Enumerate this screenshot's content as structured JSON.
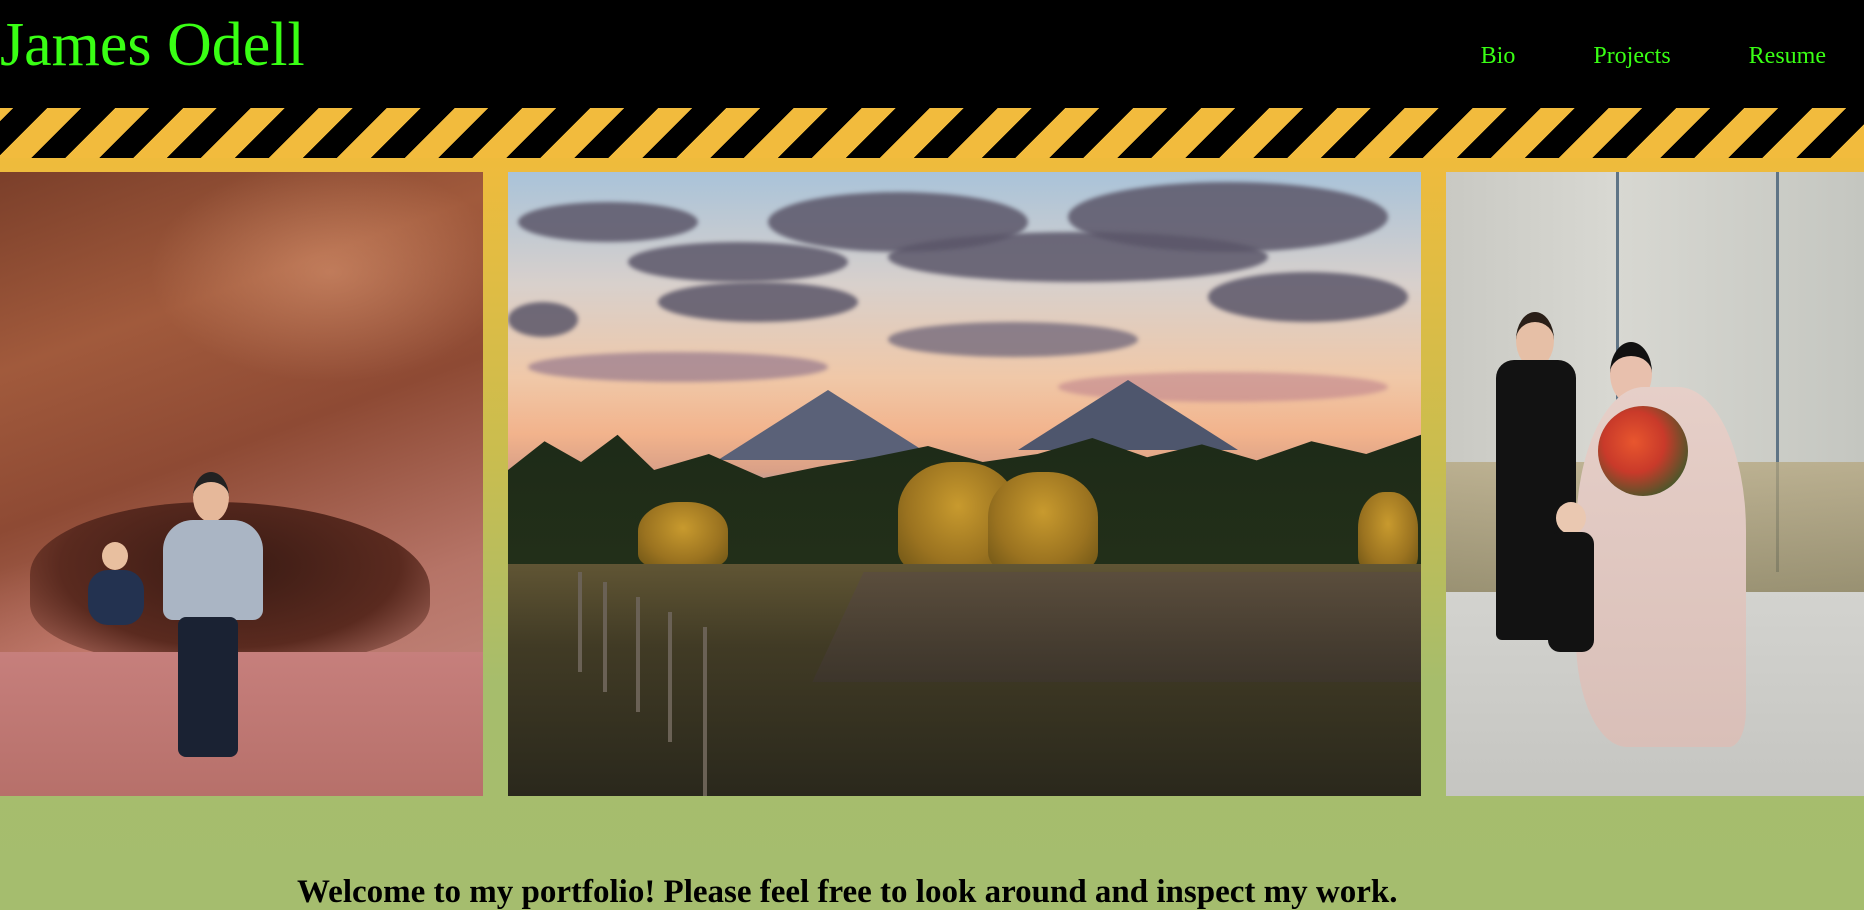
{
  "header": {
    "brand": "James Odell",
    "nav": [
      {
        "label": "Bio"
      },
      {
        "label": "Projects"
      },
      {
        "label": "Resume"
      }
    ]
  },
  "gallery": {
    "photos": [
      {
        "subject": "man and child sitting on red rock"
      },
      {
        "subject": "mountain landscape at sunset"
      },
      {
        "subject": "wedding couple with child"
      }
    ]
  },
  "main": {
    "welcome": "Welcome to my portfolio! Please feel free to look around and inspect my work."
  },
  "colors": {
    "background": "#000000",
    "brand_text": "#39ff14",
    "stripe_yellow": "#f2bb3d",
    "gallery_top": "#efbb3c",
    "gallery_bottom": "#a5bd6e"
  }
}
